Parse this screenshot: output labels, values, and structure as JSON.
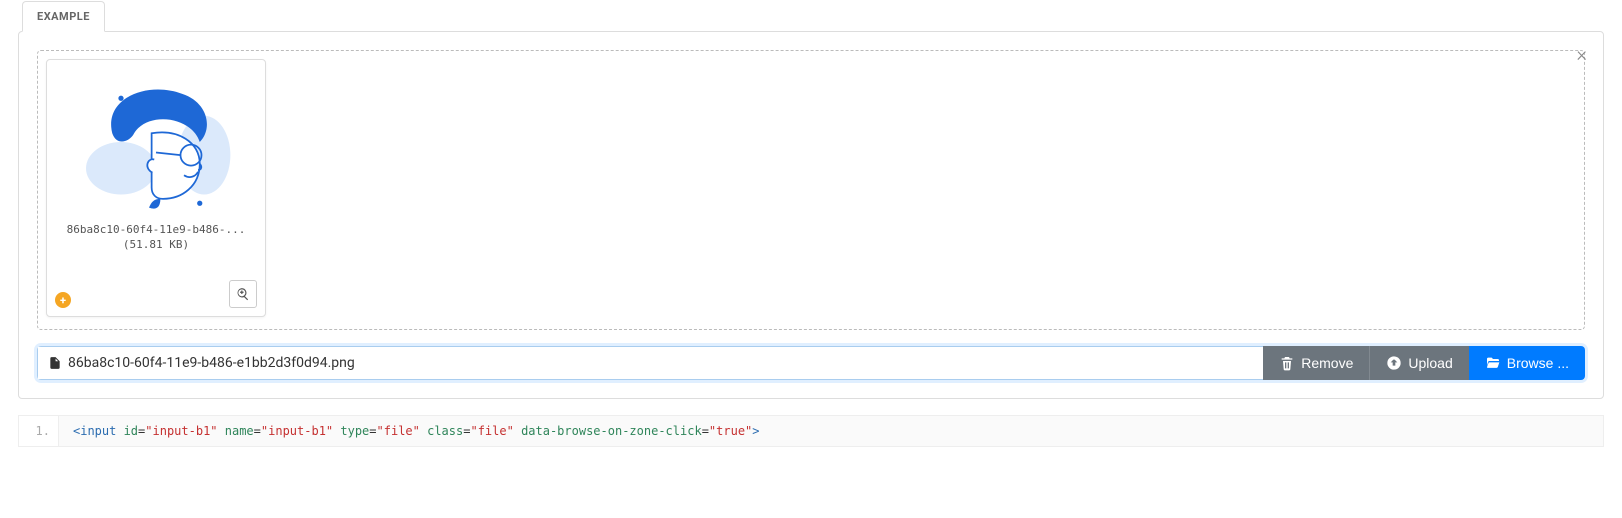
{
  "tab": {
    "label": "EXAMPLE"
  },
  "dropzone": {
    "thumb": {
      "filename_truncated": "86ba8c10-60f4-11e9-b486-...",
      "size": "(51.81 KB)"
    }
  },
  "toolbar": {
    "filename": "86ba8c10-60f4-11e9-b486-e1bb2d3f0d94.png",
    "remove_label": "Remove",
    "upload_label": "Upload",
    "browse_label": "Browse ..."
  },
  "code": {
    "line_number": "1.",
    "tokens": {
      "t1": "<input ",
      "a1": "id",
      "eq": "=",
      "v1": "\"input-b1\"",
      "a2": "name",
      "v2": "\"input-b1\"",
      "a3": "type",
      "v3": "\"file\"",
      "a4": "class",
      "v4": "\"file\"",
      "a5": "data-browse-on-zone-click",
      "v5": "\"true\"",
      "t2": ">"
    }
  }
}
